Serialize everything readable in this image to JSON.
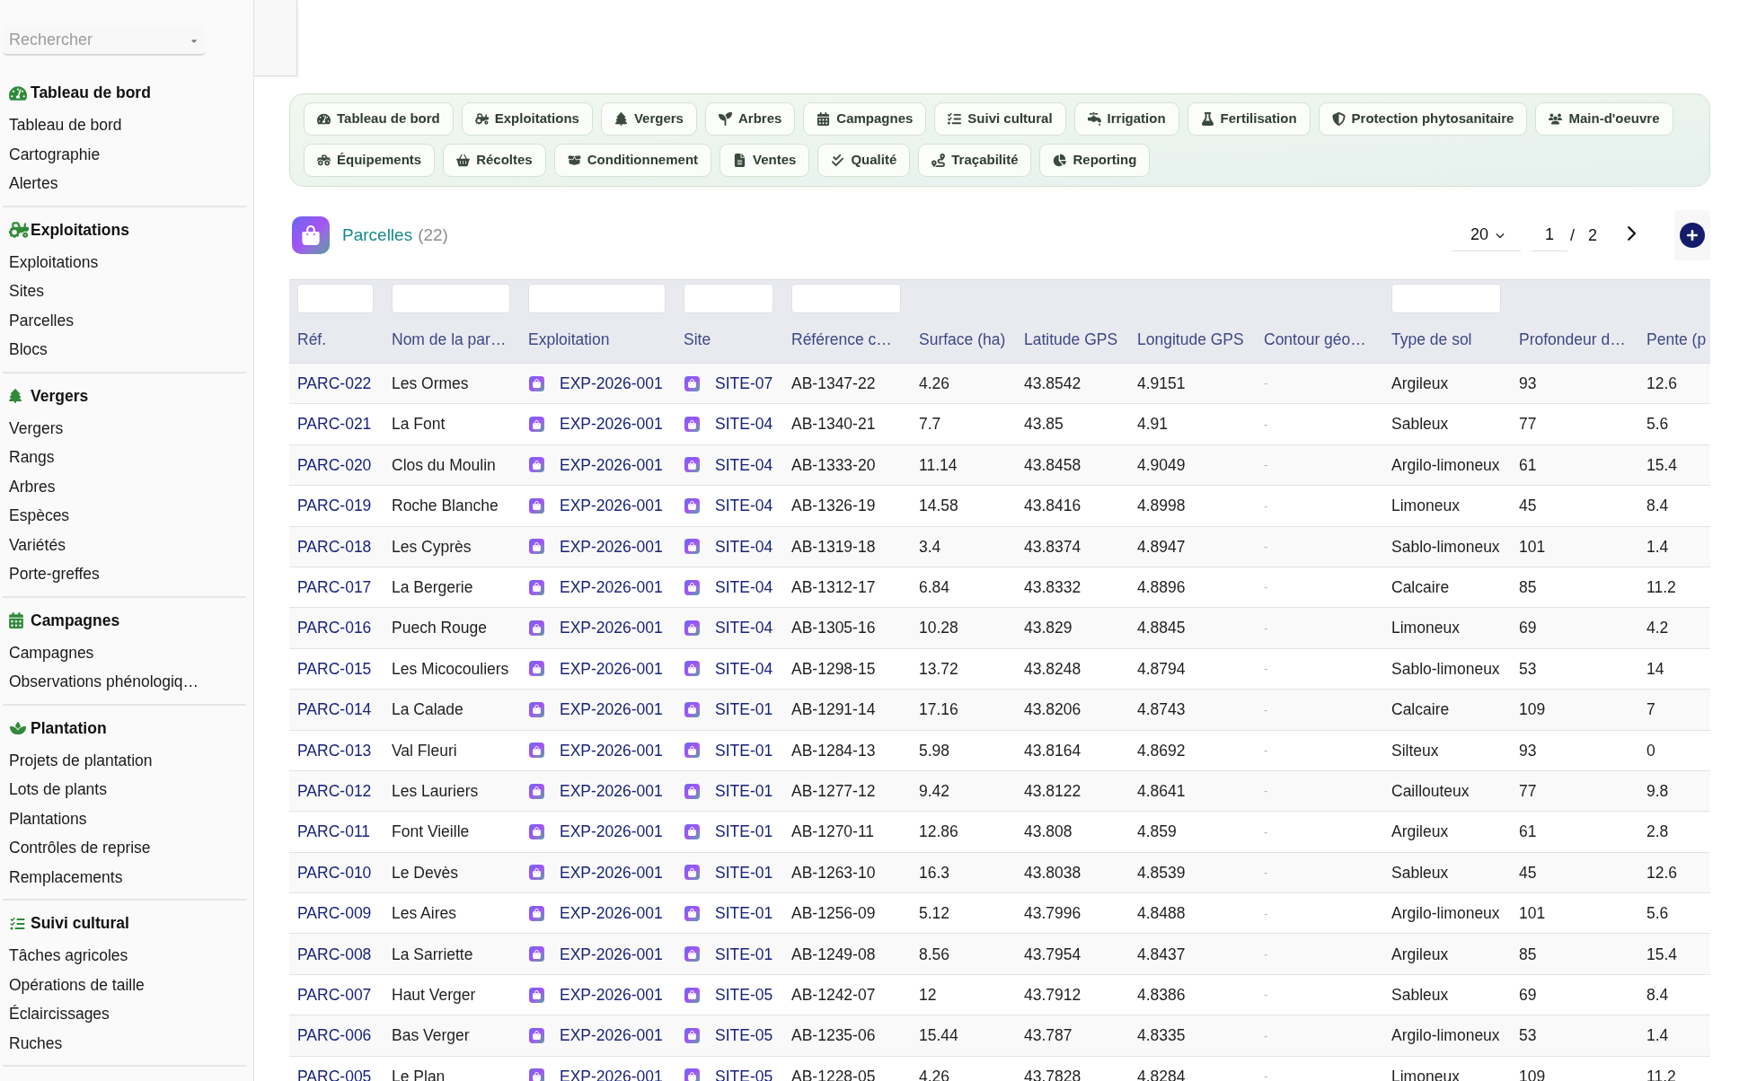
{
  "sidebar": {
    "search": {
      "placeholder": "Rechercher"
    },
    "sections": [
      {
        "title": "Tableau de bord",
        "items": [
          "Tableau de bord",
          "Cartographie",
          "Alertes"
        ]
      },
      {
        "title": "Exploitations",
        "items": [
          "Exploitations",
          "Sites",
          "Parcelles",
          "Blocs"
        ]
      },
      {
        "title": "Vergers",
        "items": [
          "Vergers",
          "Rangs",
          "Arbres",
          "Espèces",
          "Variétés",
          "Porte-greffes"
        ]
      },
      {
        "title": "Campagnes",
        "items": [
          "Campagnes",
          "Observations phénologiq…"
        ]
      },
      {
        "title": "Plantation",
        "items": [
          "Projets de plantation",
          "Lots de plants",
          "Plantations",
          "Contrôles de reprise",
          "Remplacements"
        ]
      },
      {
        "title": "Suivi cultural",
        "items": [
          "Tâches agricoles",
          "Opérations de taille",
          "Éclaircissages",
          "Ruches"
        ]
      }
    ]
  },
  "module_tabs": [
    [
      "Tableau de bord",
      "Exploitations",
      "Vergers",
      "Arbres",
      "Campagnes",
      "Suivi cultural",
      "Irrigation",
      "Fertilisation",
      "Protection phytosanitaire",
      "Main-d'oeuvre"
    ],
    [
      "Équipements",
      "Récoltes",
      "Conditionnement",
      "Ventes",
      "Qualité",
      "Traçabilité",
      "Reporting"
    ]
  ],
  "list": {
    "title": "Parcelles",
    "count": "(22)",
    "page_size": "20",
    "page": "1",
    "separator": "/",
    "page_count": "2"
  },
  "table": {
    "columns": [
      {
        "label": "Réf.",
        "kind": "link",
        "filter": true
      },
      {
        "label": "Nom de la par…",
        "kind": "text",
        "filter": true
      },
      {
        "label": "Exploitation",
        "kind": "record",
        "filter": true
      },
      {
        "label": "Site",
        "kind": "record",
        "filter": true
      },
      {
        "label": "Référence c…",
        "kind": "text",
        "filter": true
      },
      {
        "label": "Surface (ha)",
        "kind": "text",
        "filter": false
      },
      {
        "label": "Latitude GPS",
        "kind": "text",
        "filter": false
      },
      {
        "label": "Longitude GPS",
        "kind": "text",
        "filter": false
      },
      {
        "label": "Contour géo…",
        "kind": "muted",
        "filter": false
      },
      {
        "label": "Type de sol",
        "kind": "text",
        "filter": true
      },
      {
        "label": "Profondeur d…",
        "kind": "text",
        "filter": false
      },
      {
        "label": "Pente (p",
        "kind": "text",
        "filter": false
      }
    ],
    "rows": [
      [
        "PARC-022",
        "Les Ormes",
        "EXP-2026-001",
        "SITE-07",
        "AB-1347-22",
        "4.26",
        "43.8542",
        "4.9151",
        "-",
        "Argileux",
        "93",
        "12.6"
      ],
      [
        "PARC-021",
        "La Font",
        "EXP-2026-001",
        "SITE-04",
        "AB-1340-21",
        "7.7",
        "43.85",
        "4.91",
        "-",
        "Sableux",
        "77",
        "5.6"
      ],
      [
        "PARC-020",
        "Clos du Moulin",
        "EXP-2026-001",
        "SITE-04",
        "AB-1333-20",
        "11.14",
        "43.8458",
        "4.9049",
        "-",
        "Argilo-limoneux",
        "61",
        "15.4"
      ],
      [
        "PARC-019",
        "Roche Blanche",
        "EXP-2026-001",
        "SITE-04",
        "AB-1326-19",
        "14.58",
        "43.8416",
        "4.8998",
        "-",
        "Limoneux",
        "45",
        "8.4"
      ],
      [
        "PARC-018",
        "Les Cyprès",
        "EXP-2026-001",
        "SITE-04",
        "AB-1319-18",
        "3.4",
        "43.8374",
        "4.8947",
        "-",
        "Sablo-limoneux",
        "101",
        "1.4"
      ],
      [
        "PARC-017",
        "La Bergerie",
        "EXP-2026-001",
        "SITE-04",
        "AB-1312-17",
        "6.84",
        "43.8332",
        "4.8896",
        "-",
        "Calcaire",
        "85",
        "11.2"
      ],
      [
        "PARC-016",
        "Puech Rouge",
        "EXP-2026-001",
        "SITE-04",
        "AB-1305-16",
        "10.28",
        "43.829",
        "4.8845",
        "-",
        "Limoneux",
        "69",
        "4.2"
      ],
      [
        "PARC-015",
        "Les Micocouliers",
        "EXP-2026-001",
        "SITE-04",
        "AB-1298-15",
        "13.72",
        "43.8248",
        "4.8794",
        "-",
        "Sablo-limoneux",
        "53",
        "14"
      ],
      [
        "PARC-014",
        "La Calade",
        "EXP-2026-001",
        "SITE-01",
        "AB-1291-14",
        "17.16",
        "43.8206",
        "4.8743",
        "-",
        "Calcaire",
        "109",
        "7"
      ],
      [
        "PARC-013",
        "Val Fleuri",
        "EXP-2026-001",
        "SITE-01",
        "AB-1284-13",
        "5.98",
        "43.8164",
        "4.8692",
        "-",
        "Silteux",
        "93",
        "0"
      ],
      [
        "PARC-012",
        "Les Lauriers",
        "EXP-2026-001",
        "SITE-01",
        "AB-1277-12",
        "9.42",
        "43.8122",
        "4.8641",
        "-",
        "Caillouteux",
        "77",
        "9.8"
      ],
      [
        "PARC-011",
        "Font Vieille",
        "EXP-2026-001",
        "SITE-01",
        "AB-1270-11",
        "12.86",
        "43.808",
        "4.859",
        "-",
        "Argileux",
        "61",
        "2.8"
      ],
      [
        "PARC-010",
        "Le Devès",
        "EXP-2026-001",
        "SITE-01",
        "AB-1263-10",
        "16.3",
        "43.8038",
        "4.8539",
        "-",
        "Sableux",
        "45",
        "12.6"
      ],
      [
        "PARC-009",
        "Les Aires",
        "EXP-2026-001",
        "SITE-01",
        "AB-1256-09",
        "5.12",
        "43.7996",
        "4.8488",
        "-",
        "Argilo-limoneux",
        "101",
        "5.6"
      ],
      [
        "PARC-008",
        "La Sarriette",
        "EXP-2026-001",
        "SITE-01",
        "AB-1249-08",
        "8.56",
        "43.7954",
        "4.8437",
        "-",
        "Argileux",
        "85",
        "15.4"
      ],
      [
        "PARC-007",
        "Haut Verger",
        "EXP-2026-001",
        "SITE-05",
        "AB-1242-07",
        "12",
        "43.7912",
        "4.8386",
        "-",
        "Sableux",
        "69",
        "8.4"
      ],
      [
        "PARC-006",
        "Bas Verger",
        "EXP-2026-001",
        "SITE-05",
        "AB-1235-06",
        "15.44",
        "43.787",
        "4.8335",
        "-",
        "Argilo-limoneux",
        "53",
        "1.4"
      ],
      [
        "PARC-005",
        "Le Plan",
        "EXP-2026-001",
        "SITE-05",
        "AB-1228-05",
        "4.26",
        "43.7828",
        "4.8284",
        "-",
        "Limoneux",
        "109",
        "11.2"
      ]
    ]
  }
}
